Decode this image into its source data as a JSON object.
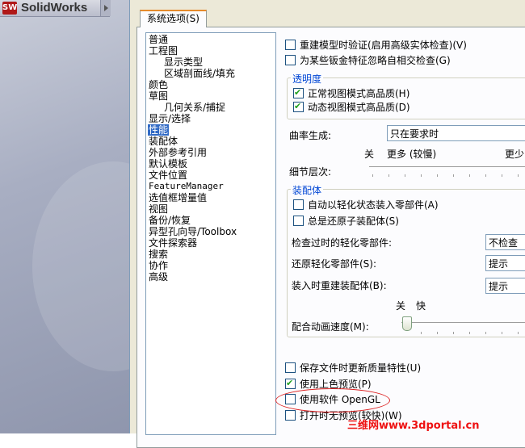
{
  "app": {
    "title": "SolidWorks",
    "logo_text": "SW"
  },
  "tab": {
    "label": "系统选项(S)"
  },
  "tree": {
    "items": [
      {
        "label": "普通"
      },
      {
        "label": "工程图"
      },
      {
        "label": "显示类型"
      },
      {
        "label": "区域剖面线/填充"
      },
      {
        "label": "颜色"
      },
      {
        "label": "草图"
      },
      {
        "label": "几何关系/捕捉"
      },
      {
        "label": "显示/选择"
      },
      {
        "label": "性能"
      },
      {
        "label": "装配体"
      },
      {
        "label": "外部参考引用"
      },
      {
        "label": "默认模板"
      },
      {
        "label": "文件位置"
      },
      {
        "label": "FeatureManager"
      },
      {
        "label": "选值框增量值"
      },
      {
        "label": "视图"
      },
      {
        "label": "备份/恢复"
      },
      {
        "label": "异型孔向导/Toolbox"
      },
      {
        "label": "文件探索器"
      },
      {
        "label": "搜索"
      },
      {
        "label": "协作"
      },
      {
        "label": "高级"
      }
    ],
    "selected": "性能"
  },
  "options": {
    "verify_rebuild": "重建模型时验证(启用高级实体检查)(V)",
    "ignore_self_intersect": "为某些钣金特征忽略自相交检查(G)",
    "transparency_group": "透明度",
    "normal_view_hq": "正常视图模式高品质(H)",
    "dynamic_view_hq": "动态视图模式高品质(D)",
    "curvature_label": "曲率生成:",
    "curvature_value": "只在要求时",
    "lod_off": "关",
    "lod_more": "更多 (较慢)",
    "lod_less": "更少",
    "lod_label": "细节层次:",
    "assembly_group": "装配体",
    "auto_lightweight": "自动以轻化状态装入零部件(A)",
    "always_resolve": "总是还原子装配体(S)",
    "check_outdated_label": "检查过时的轻化零部件:",
    "check_outdated_value": "不检查",
    "resolve_lightweight_label": "还原轻化零部件(S):",
    "resolve_lightweight_value": "提示",
    "rebuild_on_load_label": "装入时重建装配体(B):",
    "rebuild_on_load_value": "提示",
    "anim_off": "关",
    "anim_fast": "快",
    "mate_anim_label": "配合动画速度(M):",
    "update_mass_props": "保存文件时更新质量特性(U)",
    "use_shaded_preview": "使用上色预览(P)",
    "use_software_opengl": "使用软件 OpenGL",
    "no_preview_open": "打开时无预览(较快)(W)"
  },
  "watermark": "三维网www.3dportal.cn"
}
